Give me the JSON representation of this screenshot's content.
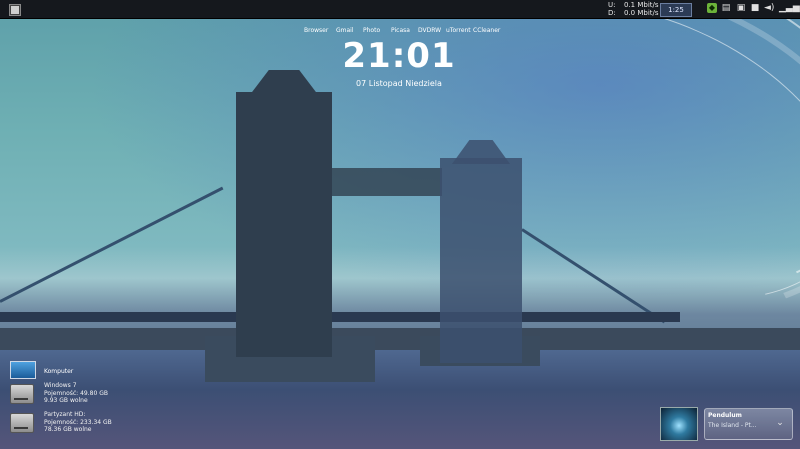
{
  "topbar": {
    "network": {
      "upload_label": "U:",
      "upload_value": "0.1 Mbit/s",
      "download_label": "D:",
      "download_value": "0.0 Mbit/s"
    },
    "graph_value": "1:25",
    "tray_icons": [
      "green-app-icon",
      "document-icon",
      "cube-icon",
      "stop-icon",
      "speaker-icon",
      "signal-icon"
    ]
  },
  "launcher": {
    "items": [
      "Browser",
      "Gmail",
      "Photo",
      "Picasa",
      "DVDRW",
      "uTorrent",
      "CCleaner"
    ]
  },
  "clock": {
    "time": "21:01",
    "date": "07 Listopad Niedziela"
  },
  "desktop": {
    "computer_label": "Komputer",
    "drives": [
      {
        "name": "Windows 7",
        "capacity": "Pojemność: 49.80 GB",
        "free": "9.93 GB wolne"
      },
      {
        "name": "Partyzant HD:",
        "capacity": "Pojemność: 233.34 GB",
        "free": "78.36 GB wolne"
      }
    ]
  },
  "media": {
    "track": "Pendulum",
    "album": "The Island - Pt..."
  }
}
